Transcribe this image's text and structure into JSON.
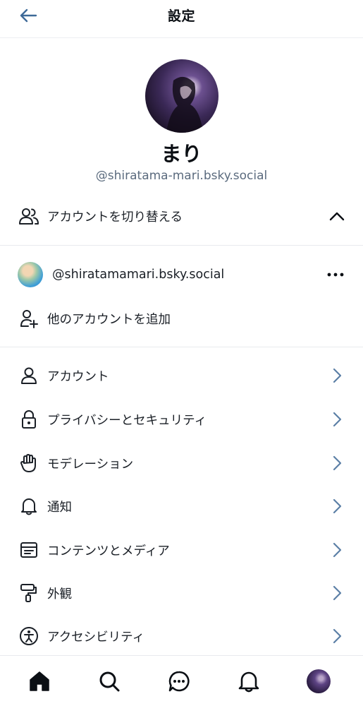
{
  "header": {
    "title": "設定",
    "back_icon": "arrow-left-icon"
  },
  "profile": {
    "display_name": "まり",
    "handle": "@shiratama-mari.bsky.social"
  },
  "account_switcher": {
    "label": "アカウントを切り替える",
    "expanded": true,
    "accounts": [
      {
        "handle": "@shiratamamari.bsky.social"
      }
    ],
    "add_account_label": "他のアカウントを追加"
  },
  "menu": {
    "items": [
      {
        "label": "アカウント",
        "icon": "person-icon"
      },
      {
        "label": "プライバシーとセキュリティ",
        "icon": "lock-icon"
      },
      {
        "label": "モデレーション",
        "icon": "hand-icon"
      },
      {
        "label": "通知",
        "icon": "bell-icon"
      },
      {
        "label": "コンテンツとメディア",
        "icon": "window-icon"
      },
      {
        "label": "外観",
        "icon": "paint-roller-icon"
      },
      {
        "label": "アクセシビリティ",
        "icon": "accessibility-icon"
      }
    ]
  },
  "tabbar": {
    "tabs": [
      "home-icon",
      "search-icon",
      "chat-icon",
      "bell-icon",
      "profile-avatar"
    ]
  },
  "colors": {
    "chevron": "#5b7fa6",
    "back_arrow": "#3e6a98",
    "text": "#0b0f14",
    "muted": "#5b6b7e"
  }
}
